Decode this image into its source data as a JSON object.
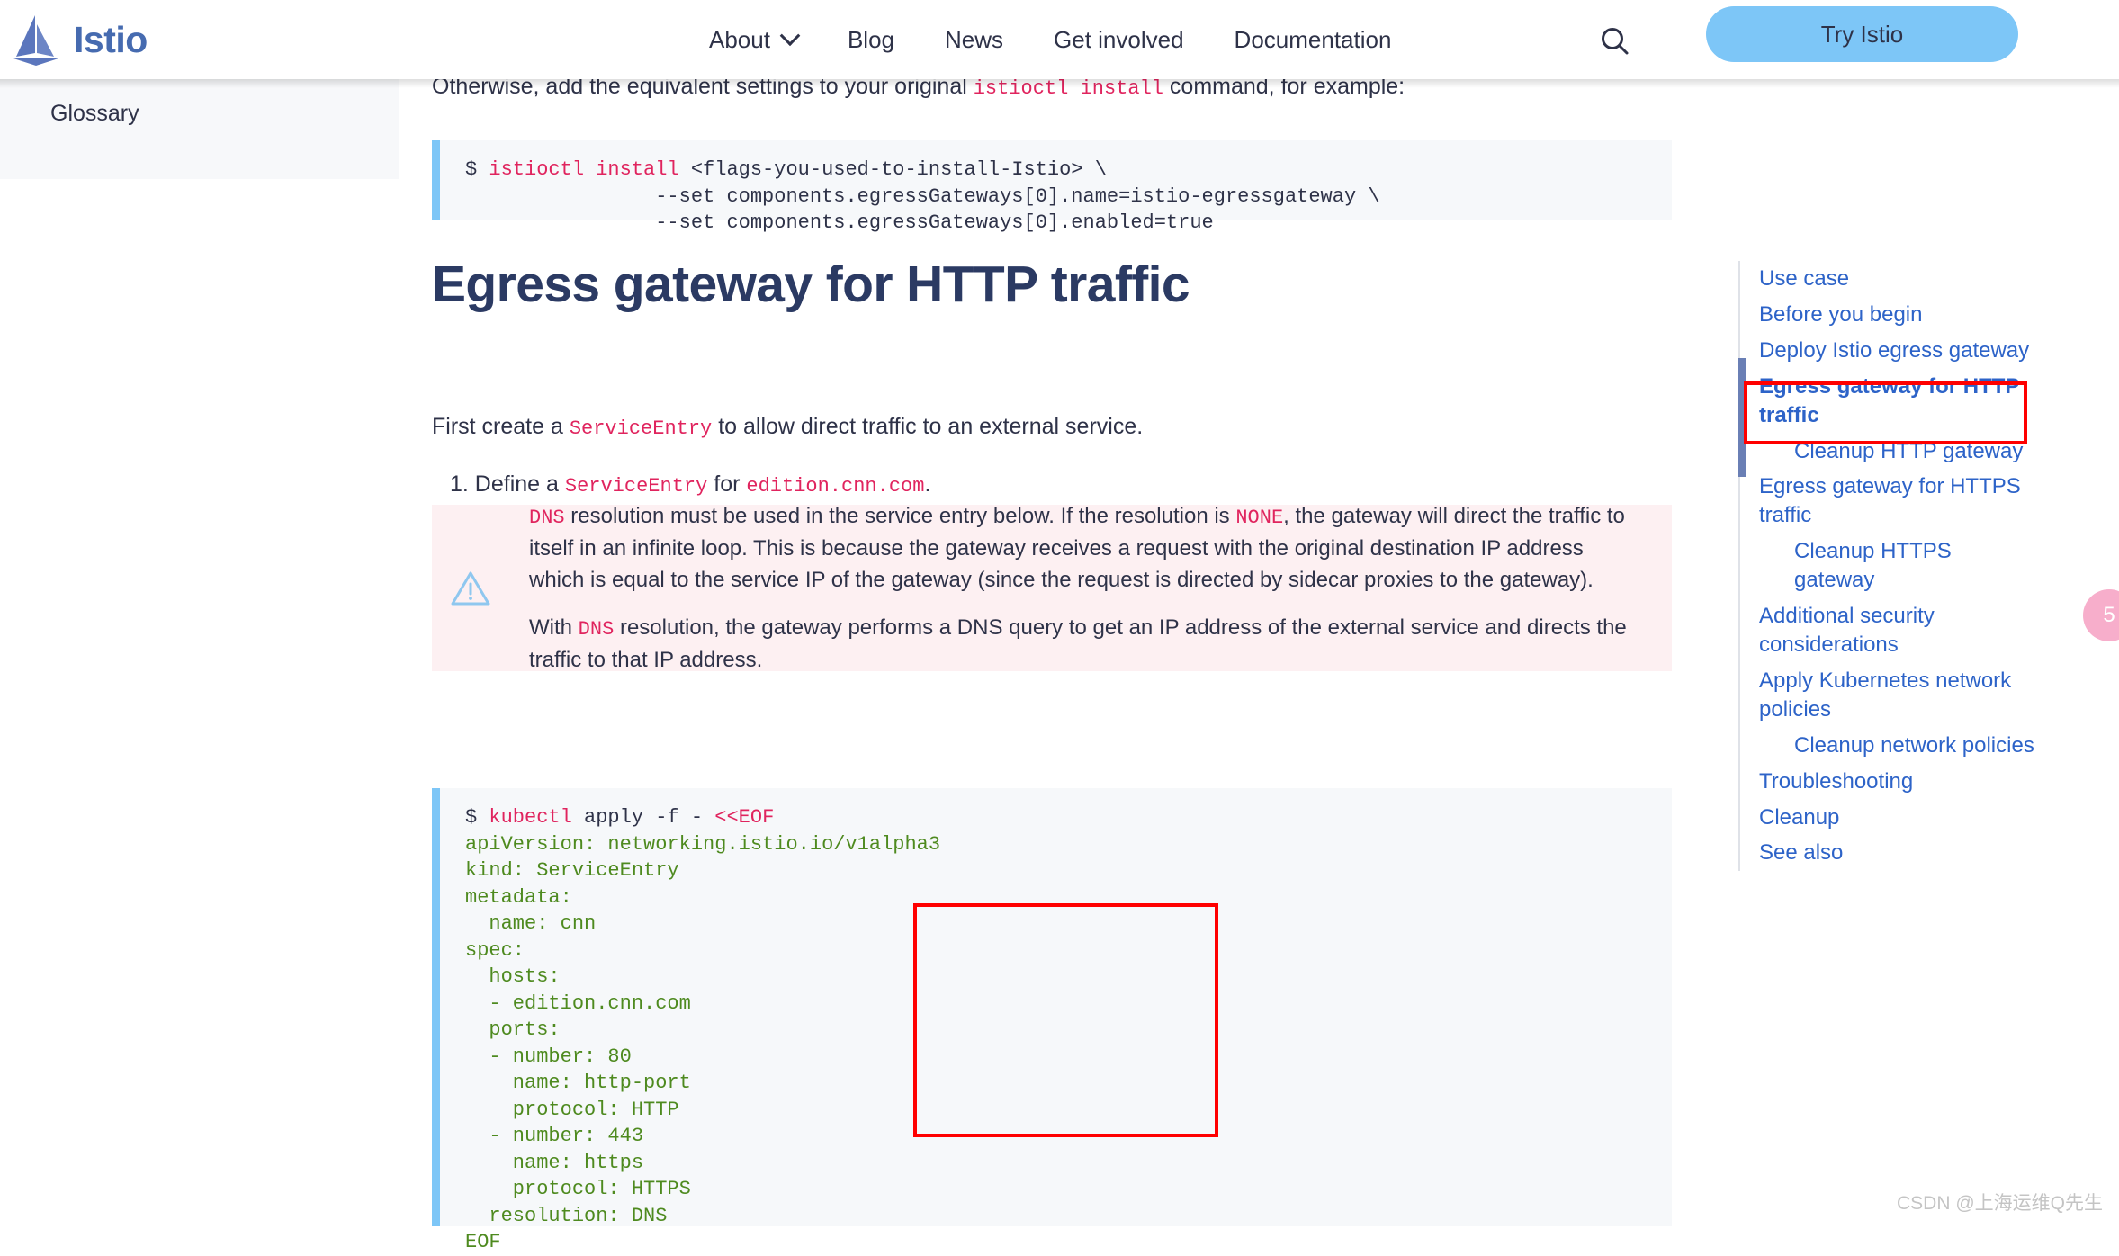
{
  "header": {
    "brand_name": "Istio",
    "brand_logo_icon": "istio-sail-logo",
    "nav": [
      {
        "label": "About",
        "has_dropdown": true,
        "icon": "chevron-down-icon"
      },
      {
        "label": "Blog",
        "has_dropdown": false
      },
      {
        "label": "News",
        "has_dropdown": false
      },
      {
        "label": "Get involved",
        "has_dropdown": false
      },
      {
        "label": "Documentation",
        "has_dropdown": false
      }
    ],
    "search_icon": "search-icon",
    "cta_label": "Try Istio",
    "cta_color": "#7dc6f7"
  },
  "left_sidebar": {
    "items": [
      {
        "label": "Glossary"
      }
    ]
  },
  "main": {
    "intro_paragraph": {
      "before": "Otherwise, add the equivalent settings to your original ",
      "code": "istioctl install",
      "after": " command, for example:"
    },
    "code_block_install": {
      "lines": [
        {
          "prompt": "$ ",
          "cmd": "istioctl install",
          "plain": " <flags-you-used-to-install-Istio> \\"
        },
        {
          "prompt": "",
          "cmd": "",
          "plain": "                --set components.egressGateways[0].name=istio-egressgateway \\"
        },
        {
          "prompt": "",
          "cmd": "",
          "plain": "                --set components.egressGateways[0].enabled=true"
        }
      ]
    },
    "heading": "Egress gateway for HTTP traffic",
    "paragraph_first": {
      "before": "First create a ",
      "code": "ServiceEntry",
      "after": " to allow direct traffic to an external service."
    },
    "list_item_1": {
      "marker": "1.",
      "before": " Define a ",
      "code1": "ServiceEntry",
      "middle": " for ",
      "code2": "edition.cnn.com",
      "after": "."
    },
    "callout": {
      "icon": "warning-triangle-icon",
      "background": "#fdf0f2",
      "paragraph_1": {
        "code1": "DNS",
        "seg1": " resolution must be used in the service entry below. If the resolution is ",
        "code2": "NONE",
        "seg2": ", the gateway will direct the traffic to itself in an infinite loop. This is because the gateway receives a request with the original destination IP address which is equal to the service IP of the gateway (since the request is directed by sidecar proxies to the gateway)."
      },
      "paragraph_2": {
        "seg1": "With ",
        "code1": "DNS",
        "seg2": " resolution, the gateway performs a DNS query to get an IP address of the external service and directs the traffic to that IP address."
      }
    },
    "code_block_yaml": {
      "command_line": {
        "prompt": "$ ",
        "cmd": "kubectl",
        "plain": " apply -f - ",
        "heredoc": "<<EOF"
      },
      "yaml_lines": [
        "apiVersion: networking.istio.io/v1alpha3",
        "kind: ServiceEntry",
        "metadata:",
        "  name: cnn",
        "spec:",
        "  hosts:",
        "  - edition.cnn.com",
        "  ports:",
        "  - number: 80",
        "    name: http-port",
        "    protocol: HTTP",
        "  - number: 443",
        "    name: https",
        "    protocol: HTTPS",
        "  resolution: DNS"
      ],
      "end_line": "EOF"
    },
    "annotation_color": "#ff0000"
  },
  "toc": {
    "items": [
      {
        "label": "Use case",
        "level": 1,
        "active": false
      },
      {
        "label": "Before you begin",
        "level": 1,
        "active": false
      },
      {
        "label": "Deploy Istio egress gateway",
        "level": 1,
        "active": false
      },
      {
        "label": "Egress gateway for HTTP traffic",
        "level": 1,
        "active": true
      },
      {
        "label": "Cleanup HTTP gateway",
        "level": 2,
        "active": false
      },
      {
        "label": "Egress gateway for HTTPS traffic",
        "level": 1,
        "active": false
      },
      {
        "label": "Cleanup HTTPS gateway",
        "level": 2,
        "active": false
      },
      {
        "label": "Additional security considerations",
        "level": 1,
        "active": false
      },
      {
        "label": "Apply Kubernetes network policies",
        "level": 1,
        "active": false
      },
      {
        "label": "Cleanup network policies",
        "level": 2,
        "active": false
      },
      {
        "label": "Troubleshooting",
        "level": 1,
        "active": false
      },
      {
        "label": "Cleanup",
        "level": 1,
        "active": false
      },
      {
        "label": "See also",
        "level": 1,
        "active": false
      }
    ],
    "link_color": "#2d63c8",
    "active_bar_color": "#6a7fb5"
  },
  "edge_widget": {
    "label": "5",
    "color": "#f7aecb"
  },
  "watermark": "CSDN @上海运维Q先生"
}
